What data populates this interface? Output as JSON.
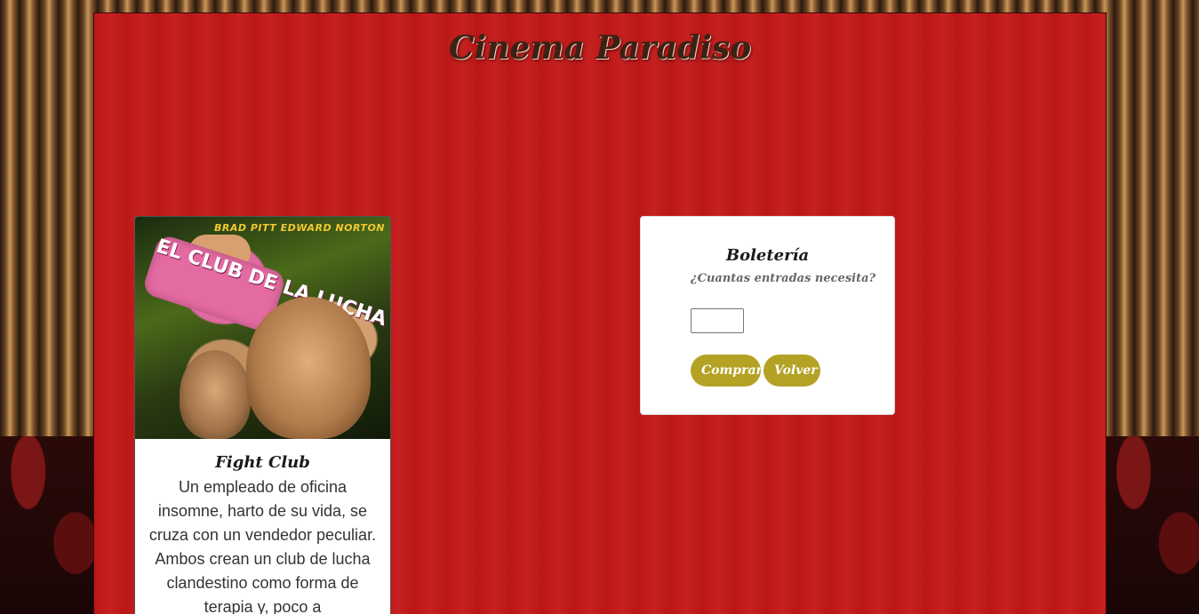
{
  "site": {
    "title": "Cinema Paradiso"
  },
  "movie": {
    "poster_credits": "BRAD PITT   EDWARD NORTON",
    "poster_logo": "EL CLUB DE LA LUCHA",
    "title": "Fight Club",
    "description": "Un empleado de oficina insomne, harto de su vida, se cruza con un vendedor peculiar. Ambos crean un club de lucha clandestino como forma de terapia y, poco a"
  },
  "ticket": {
    "title": "Boletería",
    "question": "¿Cuantas entradas necesita?",
    "quantity_value": "",
    "buy_label": "Comprar",
    "back_label": "Volver"
  },
  "colors": {
    "stage_red": "#c41919",
    "button_gold": "#b4a225",
    "title_brown": "#3b2214"
  }
}
